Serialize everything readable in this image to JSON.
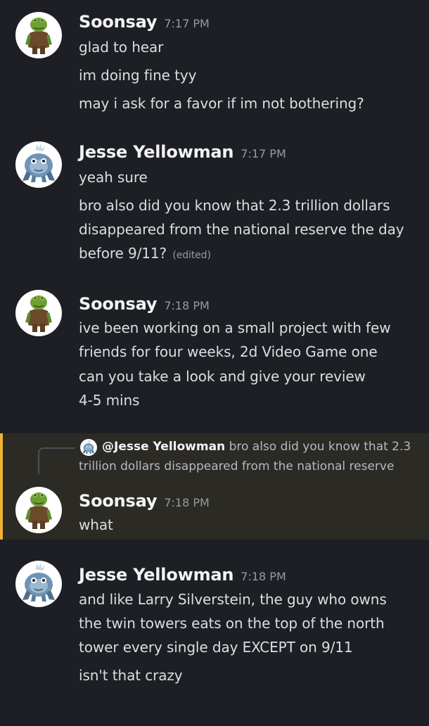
{
  "messages": [
    {
      "author": "Soonsay",
      "timestamp": "7:17 PM",
      "avatar": "frog-avatar",
      "lines": [
        "glad to hear",
        "im doing fine tyy",
        "may i ask for a favor if im not bothering?"
      ]
    },
    {
      "author": "Jesse Yellowman",
      "timestamp": "7:17 PM",
      "avatar": "blue-creature-avatar",
      "lines": [
        "yeah sure",
        "bro also did you know that 2.3 trillion dollars",
        "disappeared from the national reserve the day",
        "before 9/11?"
      ],
      "edited_label": "(edited)"
    },
    {
      "author": "Soonsay",
      "timestamp": "7:18 PM",
      "avatar": "frog-avatar",
      "lines": [
        "ive been working on a small project with few",
        "friends for four weeks, 2d Video Game one",
        "can you take a look and give your review",
        "4-5 mins"
      ]
    },
    {
      "author": "Soonsay",
      "timestamp": "7:18 PM",
      "avatar": "frog-avatar",
      "highlighted": true,
      "reply": {
        "author": "@Jesse Yellowman",
        "text_1": "bro also did you know that 2.3",
        "text_2": "trillion dollars disappeared from the national reserve"
      },
      "lines": [
        "what"
      ]
    },
    {
      "author": "Jesse Yellowman",
      "timestamp": "7:18 PM",
      "avatar": "blue-creature-avatar",
      "lines": [
        "and like Larry Silverstein, the guy who owns",
        "the twin towers eats on the top of the north",
        "tower every single day EXCEPT on 9/11",
        "isn't that crazy"
      ]
    }
  ],
  "colors": {
    "background": "#1e1f24",
    "highlight_background": "#2c2a25",
    "highlight_bar": "#f0b232",
    "author": "#f2f3f5",
    "text": "#dbdee1",
    "muted": "#949ba4"
  }
}
